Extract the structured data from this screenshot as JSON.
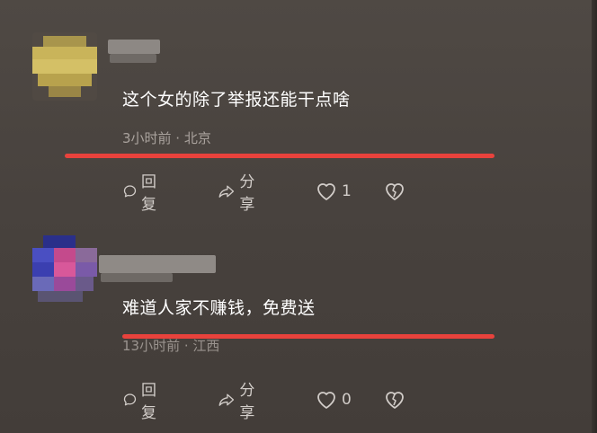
{
  "comments": [
    {
      "content": "这个女的除了举报还能干点啥",
      "meta": "3小时前 · 北京",
      "reply_label": "回复",
      "share_label": "分享",
      "like_count": "1",
      "avatar_colors": [
        "#c9b45a",
        "#b8a24d",
        "#d8c46a",
        "#a58f44"
      ]
    },
    {
      "content": "难道人家不赚钱，免费送",
      "meta": "13小时前 · 江西",
      "reply_label": "回复",
      "share_label": "分享",
      "like_count": "0",
      "avatar_colors": [
        "#3b3fb0",
        "#c44a8c",
        "#7a5aa8",
        "#2a2f8a"
      ]
    }
  ],
  "icons": {
    "reply": "comment-bubble-icon",
    "share": "share-arrow-icon",
    "like": "heart-icon",
    "dislike": "broken-heart-icon"
  },
  "colors": {
    "underline": "#e8423c",
    "text": "#ffffff",
    "meta": "#a9a29d"
  }
}
